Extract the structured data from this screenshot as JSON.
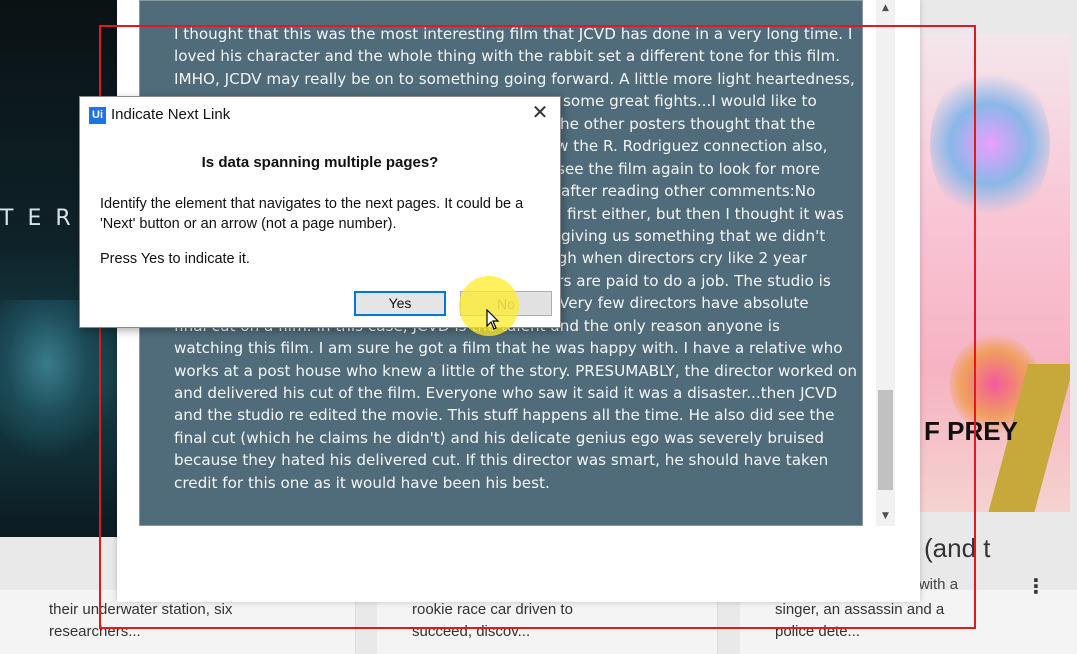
{
  "background": {
    "left_card_text": [
      "their underwater station, six",
      "researchers..."
    ],
    "middle_card_text": [
      "rookie race car driven to",
      "succeed, discov..."
    ],
    "right_card_text": [
      "singer, an assassin and a",
      "police dete..."
    ],
    "right_card_title": "(and t",
    "right_card_desc": "orces with a",
    "left_poster_letters": "TER",
    "right_poster_text": "F PREY"
  },
  "review": {
    "lines": [
      "I thought that this was the most interesting film that JCVD has done in a very long time. I",
      "loved his character and the whole thing with the rabbit set a different tone for this film.",
      "IMHO, JCDV may really be on to something going forward. A little more light heartedness,",
      "some great fights...I would like to",
      "he other posters thought that the",
      "w the R. Rodriguez connection also,",
      "see the film again to look for more",
      "after reading other comments:No",
      "first either, but then I thought it was",
      "giving us something that we didn't",
      "ugh when directors cry like 2 year",
      "ors are paid to do a job. The studio is",
      "Very few directors have absolute",
      "final cut on a film. In this case, JCVD is the talent and the only reason anyone is",
      "watching this film. I am sure he got a film that he was happy with. I have a relative who",
      "works at a post house who knew a little of the story. PRESUMABLY, the director worked on",
      "and delivered his cut of the film. Everyone who saw it said it was a disaster...then JCVD",
      "and the studio re edited the movie. This stuff happens all the time. He also did see the",
      "final cut (which he claims he didn't) and his delicate genius ego was severely bruised",
      "because they hated his delivered cut. If this director was smart, he should have taken",
      "credit for this one as it would have been his best."
    ]
  },
  "dialog": {
    "logo": "Ui",
    "title": "Indicate Next Link",
    "question": "Is data spanning multiple pages?",
    "description": "Identify the element that navigates to the next pages. It could be a 'Next' button or an arrow (not a page number).",
    "hint": "Press Yes to indicate it.",
    "yes_label": "Yes",
    "no_label": "No"
  }
}
